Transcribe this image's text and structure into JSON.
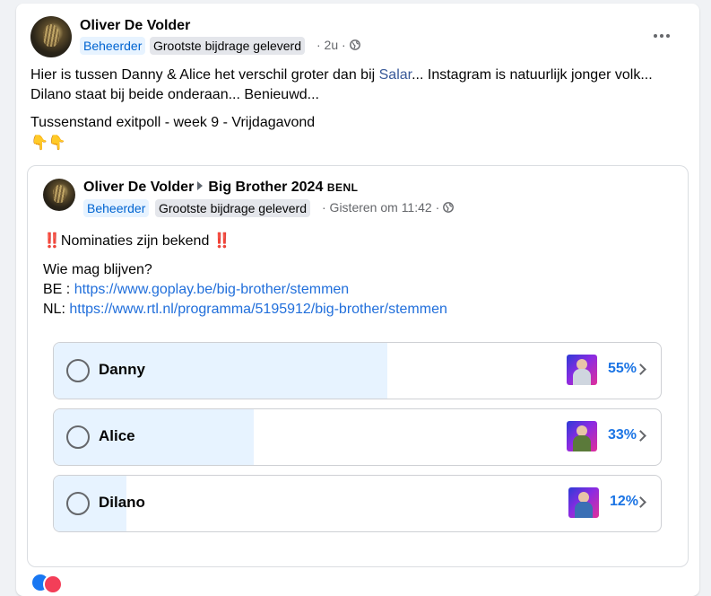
{
  "post": {
    "author": "Oliver De Volder",
    "badge_admin": "Beheerder",
    "badge_contrib": "Grootste bijdrage geleverd",
    "time": "· 2u ·",
    "line1_prefix": "Hier is tussen Danny & Alice het verschil groter dan bij ",
    "line1_link": "Salar",
    "line1_suffix": "... Instagram is natuurlijk jonger volk...",
    "line2": "Dilano staat bij beide onderaan... Benieuwd...",
    "line3": "Tussenstand exitpoll - week 9 - Vrijdagavond",
    "emoji": "👇👇"
  },
  "shared": {
    "author": "Oliver De Volder",
    "group": "Big Brother 2024",
    "group_tag": "BENL",
    "badge_admin": "Beheerder",
    "badge_contrib": "Grootste bijdrage geleverd",
    "time": "· Gisteren om 11:42 ·",
    "headline_mark": "‼️",
    "headline": "Nominaties zijn bekend",
    "question": "Wie mag blijven?",
    "be_label": "BE : ",
    "be_url": "https://www.goplay.be/big-brother/stemmen",
    "nl_label": "NL: ",
    "nl_url": "https://www.rtl.nl/programma/5195912/big-brother/stemmen"
  },
  "poll": {
    "options": [
      {
        "label": "Danny",
        "percent_text": "55%",
        "share": 0.55
      },
      {
        "label": "Alice",
        "percent_text": "33%",
        "share": 0.33
      },
      {
        "label": "Dilano",
        "percent_text": "12%",
        "share": 0.12
      }
    ],
    "fill_color": "#e7f3ff"
  },
  "colors": {
    "admin_badge_text": "#0064d1",
    "link": "#216fdb",
    "percent": "#1b74e4"
  }
}
